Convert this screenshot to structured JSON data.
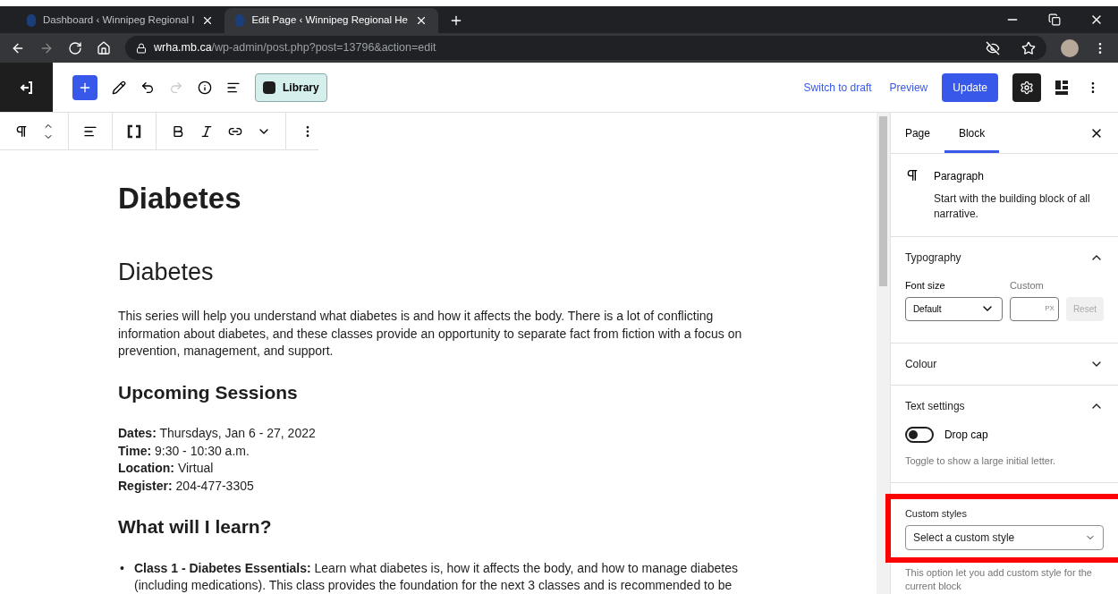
{
  "browser": {
    "tabs": [
      {
        "title": "Dashboard ‹ Winnipeg Regional I",
        "selected": false
      },
      {
        "title": "Edit Page ‹ Winnipeg Regional He",
        "selected": true
      }
    ],
    "url": {
      "domain": "wrha.mb.ca",
      "path": "/wp-admin/post.php?post=13796&action=edit"
    }
  },
  "header": {
    "library": "Library",
    "switch_to_draft": "Switch to draft",
    "preview": "Preview",
    "update": "Update",
    "settings_open": true
  },
  "content": {
    "title": "Diabetes",
    "blocks": [
      {
        "kind": "h2",
        "text": "Diabetes"
      },
      {
        "kind": "p",
        "text": "This series will help you understand what diabetes is and how it affects the body. There is a lot of conflicting information about diabetes, and these classes provide an opportunity to separate fact from fiction with a focus on prevention, management, and support."
      },
      {
        "kind": "h3",
        "text": "Upcoming Sessions"
      },
      {
        "kind": "lines",
        "lines": [
          "**Dates:** Thursdays, Jan 6 - 27, 2022",
          "**Time:** 9:30 - 10:30 a.m.",
          "**Location:** Virtual",
          "**Register:** 204-477-3305"
        ]
      },
      {
        "kind": "h3",
        "text": "What will I learn?"
      },
      {
        "kind": "list",
        "marker": "•",
        "items": [
          "**Class 1 - Diabetes Essentials:** Learn what diabetes is, how it affects the body, and how to manage diabetes (including medications). This class provides the foundation for the next 3 classes and is recommended to be"
        ]
      }
    ]
  },
  "sidebar": {
    "tabs": [
      {
        "label": "Page",
        "selected": false
      },
      {
        "label": "Block",
        "selected": true
      }
    ],
    "block": {
      "name": "Paragraph",
      "description": "Start with the building block of all narrative."
    },
    "panels": [
      {
        "kind": "typography",
        "title": "Typography",
        "expanded": true,
        "font_size_label": "Font size",
        "font_size": "Default",
        "custom_label": "Custom",
        "unit": "PX",
        "reset": "Reset",
        "reset_disabled": true
      },
      {
        "kind": "plain",
        "title": "Colour",
        "expanded": false
      },
      {
        "kind": "text_settings",
        "title": "Text settings",
        "expanded": true,
        "toggle_label": "Drop cap",
        "toggle_on": false,
        "help": "Toggle to show a large initial letter."
      },
      {
        "kind": "custom_styles",
        "label": "Custom styles",
        "placeholder": "Select a custom style",
        "help": "This option let you add custom style for the current block",
        "highlighted": true
      }
    ]
  }
}
